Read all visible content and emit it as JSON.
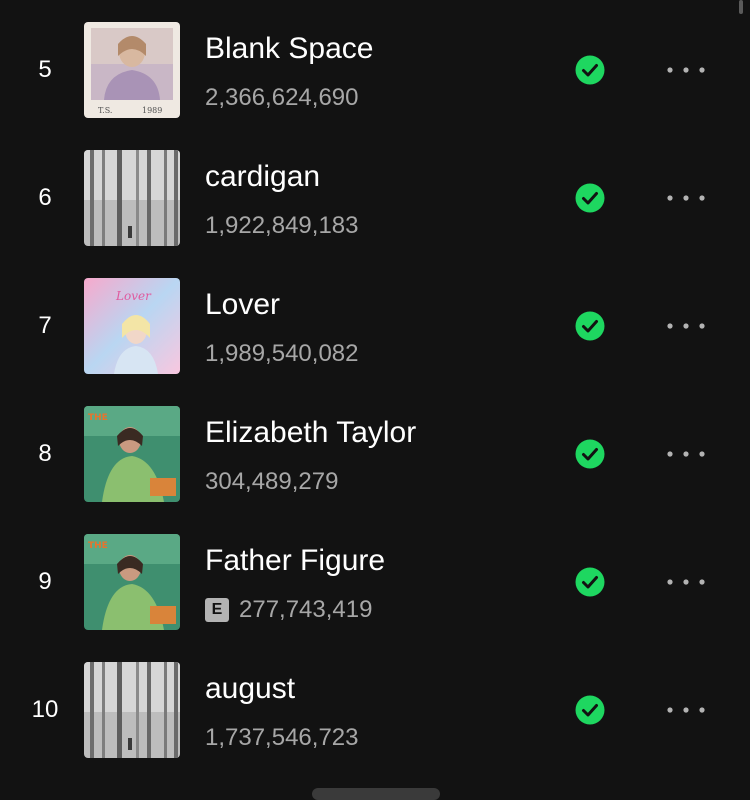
{
  "colors": {
    "background": "#121212",
    "text_primary": "#ffffff",
    "text_secondary": "#a7a7a7",
    "saved_green": "#1ed760"
  },
  "icons": {
    "saved": "check-circle-icon",
    "more": "more-options-icon",
    "explicit": "explicit-icon"
  },
  "tracks": [
    {
      "rank": "5",
      "title": "Blank Space",
      "plays": "2,366,624,690",
      "explicit": false
    },
    {
      "rank": "6",
      "title": "cardigan",
      "plays": "1,922,849,183",
      "explicit": false
    },
    {
      "rank": "7",
      "title": "Lover",
      "plays": "1,989,540,082",
      "explicit": false
    },
    {
      "rank": "8",
      "title": "Elizabeth Taylor",
      "plays": "304,489,279",
      "explicit": false
    },
    {
      "rank": "9",
      "title": "Father Figure",
      "plays": "277,743,419",
      "explicit": true,
      "explicit_label": "E"
    },
    {
      "rank": "10",
      "title": "august",
      "plays": "1,737,546,723",
      "explicit": false
    }
  ]
}
